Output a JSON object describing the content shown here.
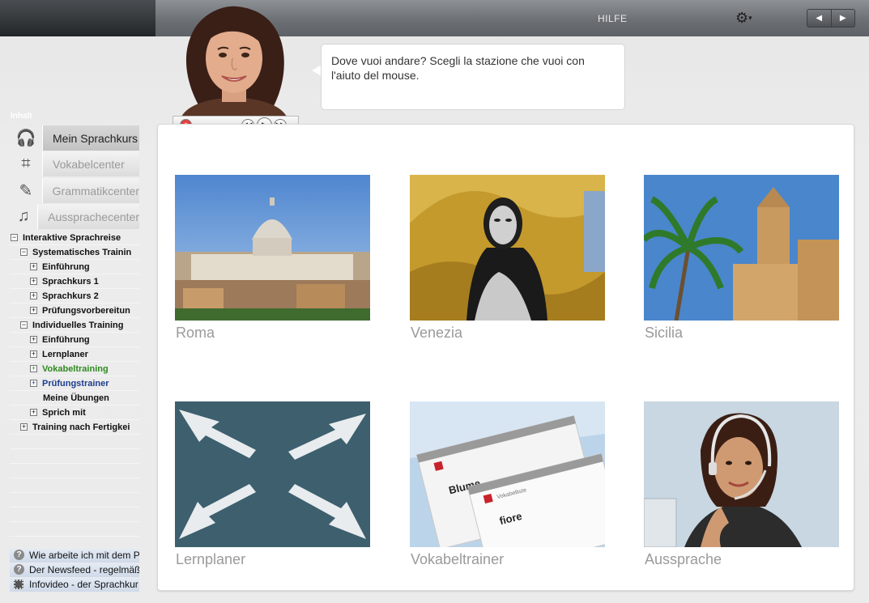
{
  "header": {
    "help_label": "HILFE",
    "settings_icon": "gear-icon",
    "back_icon": "◀",
    "forward_icon": "▶"
  },
  "tutor": {
    "message": "Dove vuoi andare? Scegli la stazione che vuoi con l'aiuto del mouse."
  },
  "sidebar": {
    "section_label": "Inhalt",
    "centers": [
      {
        "label": "Mein Sprachkurs",
        "active": true
      },
      {
        "label": "Vokabelcenter",
        "active": false
      },
      {
        "label": "Grammatikcenter",
        "active": false
      },
      {
        "label": "Aussprachecenter",
        "active": false
      }
    ],
    "tree": [
      {
        "label": "Interaktive Sprachreise",
        "toggle": "−"
      },
      {
        "label": "Systematisches Trainin",
        "toggle": "−"
      },
      {
        "label": "Einführung",
        "toggle": "+"
      },
      {
        "label": "Sprachkurs 1",
        "toggle": "+"
      },
      {
        "label": "Sprachkurs 2",
        "toggle": "+"
      },
      {
        "label": "Prüfungsvorbereitun",
        "toggle": "+"
      },
      {
        "label": "Individuelles Training",
        "toggle": "−"
      },
      {
        "label": "Einführung",
        "toggle": "+"
      },
      {
        "label": "Lernplaner",
        "toggle": "+"
      },
      {
        "label": "Vokabeltraining",
        "toggle": "+"
      },
      {
        "label": "Prüfungstrainer",
        "toggle": "+"
      },
      {
        "label": "Meine Übungen",
        "toggle": ""
      },
      {
        "label": "Sprich mit",
        "toggle": "+"
      },
      {
        "label": "Training nach Fertigkei",
        "toggle": "+"
      }
    ],
    "help_links": [
      {
        "label": "Wie arbeite ich mit dem P"
      },
      {
        "label": "Der Newsfeed - regelmäß"
      },
      {
        "label": "Infovideo - der Sprachkur"
      }
    ]
  },
  "stations": [
    {
      "label": "Roma"
    },
    {
      "label": "Venezia"
    },
    {
      "label": "Sicilia"
    },
    {
      "label": "Lernplaner"
    },
    {
      "label": "Vokabeltrainer"
    },
    {
      "label": "Aussprache"
    }
  ],
  "card_texts": {
    "word1": "Blume",
    "word2": "fiore",
    "tag": "Vokabelliste"
  }
}
